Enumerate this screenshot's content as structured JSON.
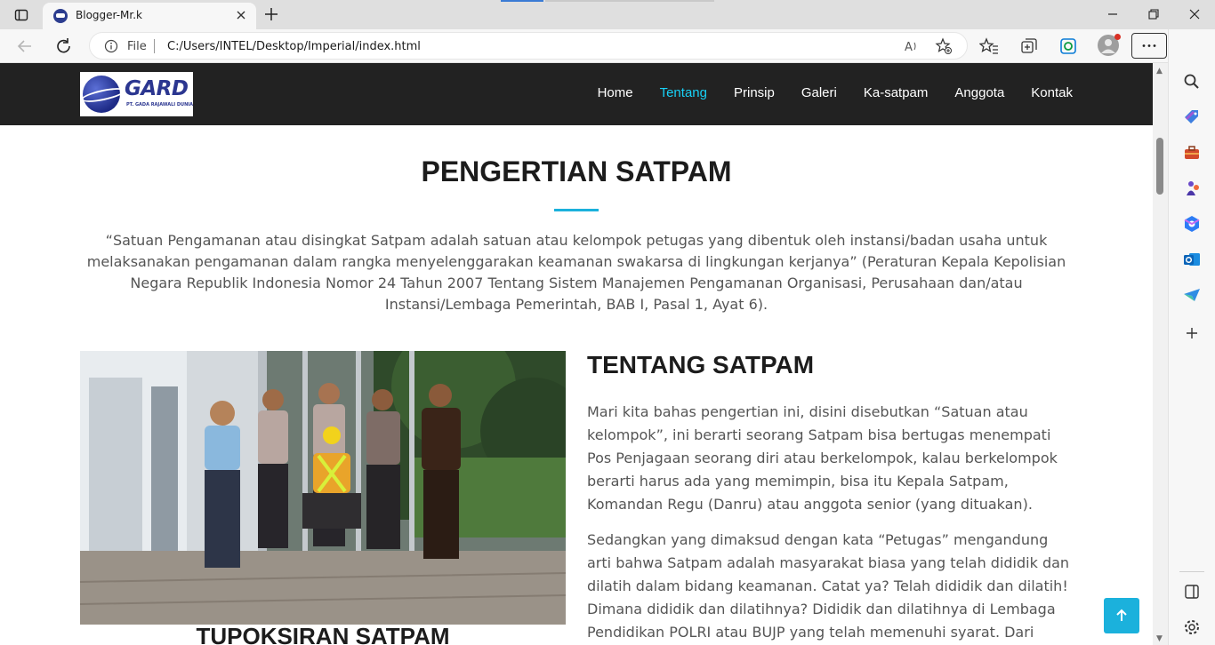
{
  "browser": {
    "tab_title": "Blogger-Mr.k",
    "address_scheme_label": "File",
    "address_url": "C:/Users/INTEL/Desktop/Imperial/index.html"
  },
  "site": {
    "logo_text": "GARD",
    "logo_tagline": "PT. GADA RAJAWALI DUNIA",
    "nav": [
      {
        "label": "Home",
        "active": false
      },
      {
        "label": "Tentang",
        "active": true
      },
      {
        "label": "Prinsip",
        "active": false
      },
      {
        "label": "Galeri",
        "active": false
      },
      {
        "label": "Ka-satpam",
        "active": false
      },
      {
        "label": "Anggota",
        "active": false
      },
      {
        "label": "Kontak",
        "active": false
      }
    ],
    "accent_color": "#1bb1dc"
  },
  "content": {
    "title": "PENGERTIAN SATPAM",
    "intro": "“Satuan Pengamanan atau disingkat Satpam adalah satuan atau kelompok petugas yang dibentuk oleh instansi/badan usaha untuk melaksanakan pengamanan dalam rangka menyelenggarakan keamanan swakarsa di lingkungan kerjanya” (Peraturan Kepala Kepolisian Negara Republik Indonesia Nomor 24 Tahun 2007 Tentang Sistem Manajemen Pengamanan Organisasi, Perusahaan dan/atau Instansi/Lembaga Pemerintah, BAB I, Pasal 1, Ayat 6).",
    "about_heading": "TENTANG SATPAM",
    "paragraph1": "Mari kita bahas pengertian ini, disini disebutkan “Satuan atau kelompok”, ini berarti seorang Satpam bisa bertugas menempati Pos Penjagaan seorang diri atau berkelompok, kalau berkelompok berarti harus ada yang memimpin, bisa itu Kepala Satpam, Komandan Regu (Danru) atau anggota senior (yang dituakan).",
    "paragraph2": "Sedangkan yang dimaksud dengan kata “Petugas” mengandung arti bahwa Satpam adalah masyarakat biasa yang telah dididik dan dilatih dalam bidang keamanan. Catat ya? Telah dididik dan dilatih! Dimana dididik dan dilatihnya? Dididik dan dilatihnya di Lembaga Pendidikan POLRI atau BUJP yang telah memenuhi syarat. Dari mana Sertifikat",
    "section2_heading": "TUPOKSIRAN SATPAM"
  }
}
